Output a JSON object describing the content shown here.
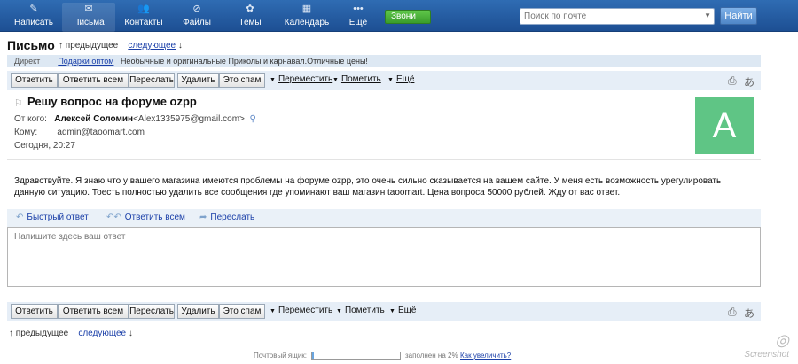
{
  "nav": {
    "items": [
      {
        "label": "Написать",
        "icon": "pencil-icon"
      },
      {
        "label": "Письма",
        "icon": "envelope-icon"
      },
      {
        "label": "Контакты",
        "icon": "contacts-icon"
      },
      {
        "label": "Файлы",
        "icon": "paperclip-icon"
      },
      {
        "label": "Темы",
        "icon": "palette-icon"
      },
      {
        "label": "Календарь",
        "icon": "calendar-icon"
      },
      {
        "label": "Ещё",
        "icon": "more-dots-icon"
      }
    ],
    "call_label": "Звони",
    "search_placeholder": "Поиск по почте",
    "find_label": "Найти"
  },
  "header": {
    "title": "Письмо",
    "prev": "предыдущее",
    "next": "следующее"
  },
  "ad": {
    "direct": "Директ",
    "link": "Подарки оптом",
    "text": "Необычные и оригинальные Приколы и карнавал.Отличные цены!"
  },
  "toolbar": {
    "reply": "Ответить",
    "reply_all": "Ответить всем",
    "forward": "Переслать",
    "delete": "Удалить",
    "spam": "Это спам",
    "move": "Переместить",
    "mark": "Пометить",
    "more": "Ещё"
  },
  "message": {
    "subject": "Решу вопрос на форуме ozpp",
    "from_label": "От кого:",
    "from_name": "Алексей Соломин",
    "from_email": "<Alex1335975@gmail.com>",
    "to_label": "Кому:",
    "to_value": "admin@taoomart.com",
    "date": "Сегодня, 20:27",
    "avatar_letter": "A",
    "body": "Здравствуйте. Я знаю что у вашего магазина имеются проблемы на форуме ozpp, это очень сильно сказывается на вашем сайте. У меня есть возможность урегулировать данную ситуацию. Тоесть полностью удалить все сообщения где упоминают ваш магазин taoomart. Цена вопроса 50000 рублей. Жду от вас ответ."
  },
  "quick_reply": {
    "quick": "Быстрый ответ",
    "reply_all": "Ответить всем",
    "forward": "Переслать",
    "placeholder": "Напишите здесь ваш ответ"
  },
  "footer": {
    "mailbox_label": "Почтовый ящик:",
    "filled_text": "заполнен на 2%",
    "filled_fraction": 0.02,
    "increase_link": "Как увеличить?"
  },
  "watermark": "Screenshot",
  "colors": {
    "nav_bg": "#2a62a8",
    "call_green": "#4caf3a",
    "avatar_green": "#5fc585",
    "link_blue": "#1a3fa8"
  }
}
